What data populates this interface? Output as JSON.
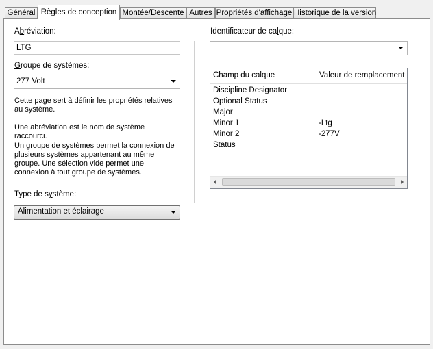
{
  "tabs": [
    "Général",
    "Règles de conception",
    "Montée/Descente",
    "Autres",
    "Propriétés d'affichage",
    "Historique de la version"
  ],
  "active_tab": "Règles de conception",
  "left": {
    "abbr_label_pre": "A",
    "abbr_label_u": "b",
    "abbr_label_post": "réviation:",
    "abbr_value": "LTG",
    "group_label_u": "G",
    "group_label_post": "roupe de systèmes:",
    "group_value": "277 Volt",
    "desc1": "Cette page sert à définir les propriétés relatives au système.",
    "desc2": "Une abréviation est le nom de système raccourci.",
    "desc3": "Un groupe de systèmes permet la connexion de plusieurs systèmes appartenant au même groupe. Une sélection vide permet une connexion à tout groupe de systèmes.",
    "type_label_pre": "Type de s",
    "type_label_u": "y",
    "type_label_post": "stème:",
    "type_value": "Alimentation et éclairage"
  },
  "right": {
    "layer_label_pre": "Identificateur de ca",
    "layer_label_u": "l",
    "layer_label_post": "que:",
    "layer_value": "",
    "columns": [
      "Champ du calque",
      "Valeur de remplacement"
    ],
    "rows": [
      {
        "field": "Discipline Designator",
        "value": ""
      },
      {
        "field": "Optional Status",
        "value": ""
      },
      {
        "field": "Major",
        "value": ""
      },
      {
        "field": "Minor 1",
        "value": "-Ltg"
      },
      {
        "field": "Minor 2",
        "value": "-277V"
      },
      {
        "field": "Status",
        "value": ""
      }
    ]
  }
}
